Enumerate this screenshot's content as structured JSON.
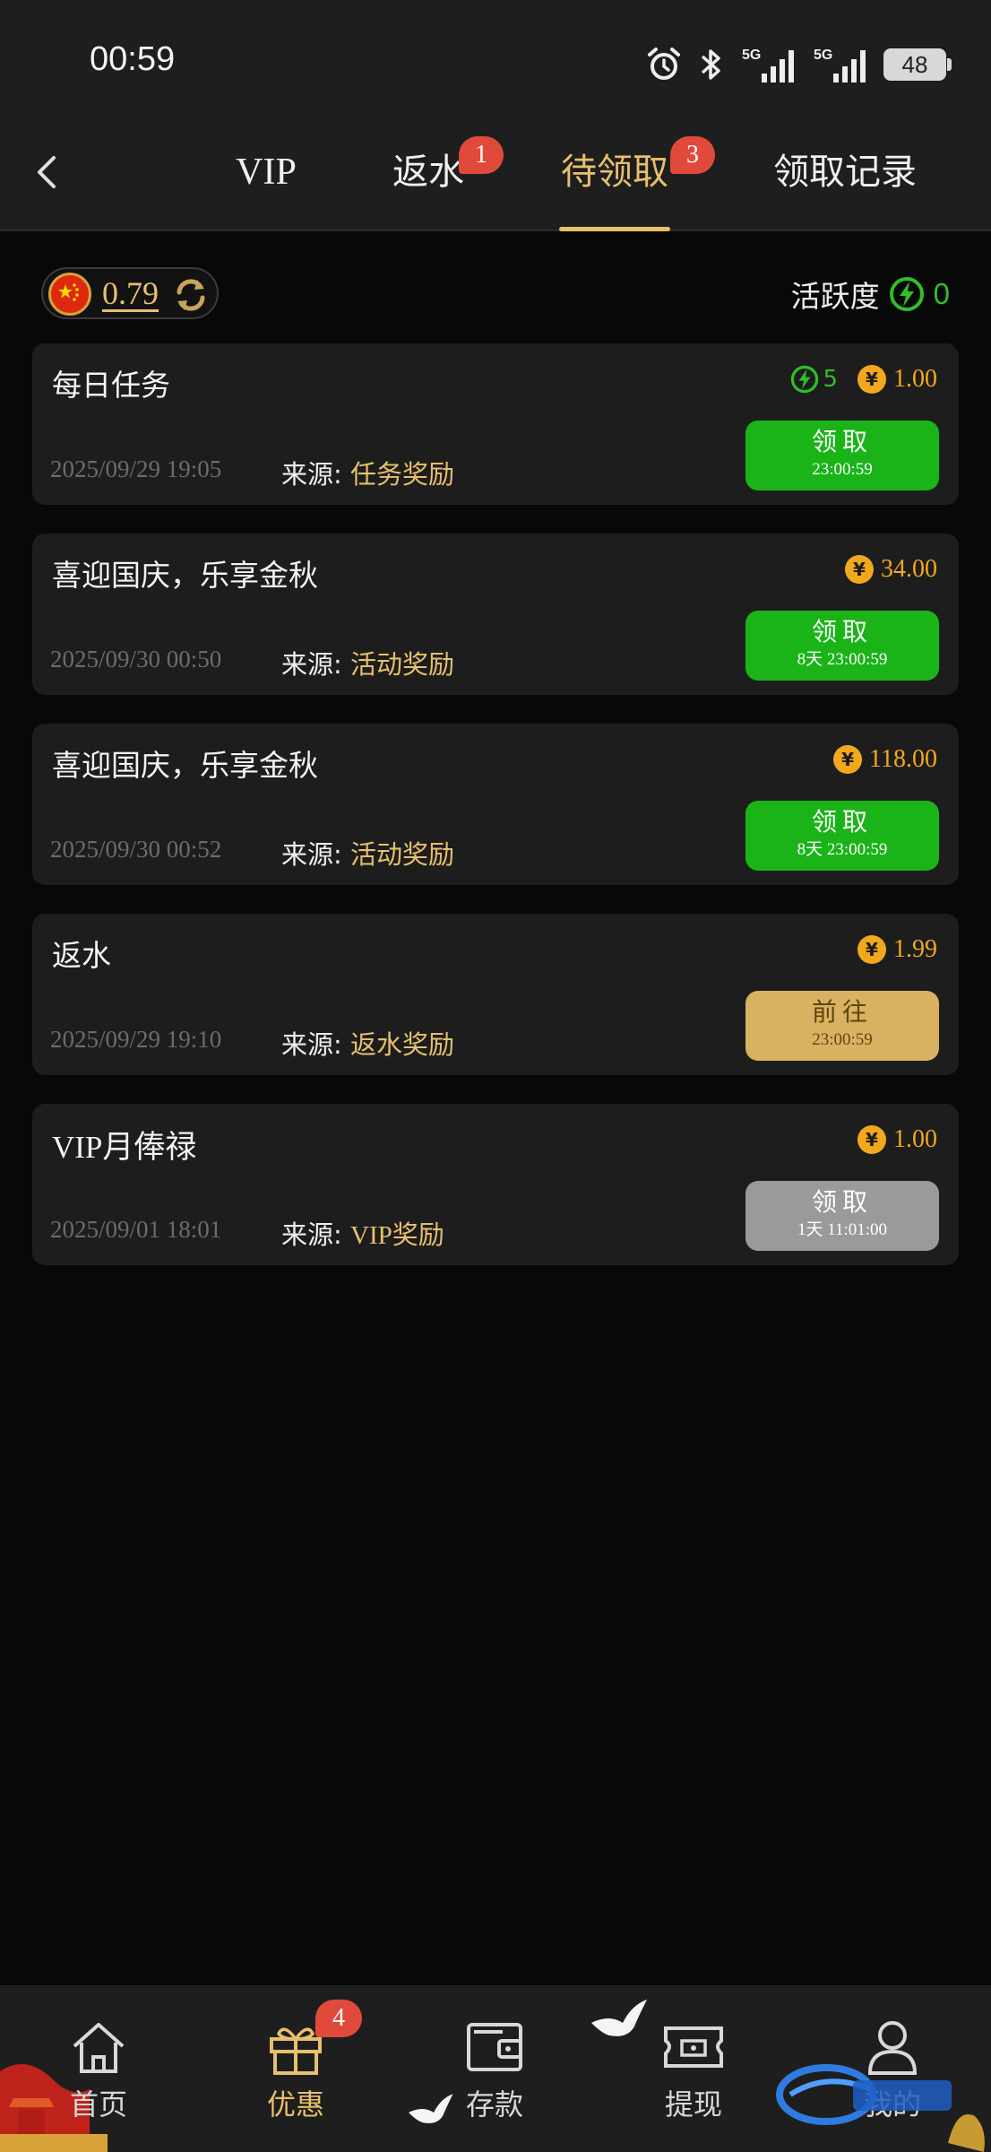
{
  "status_bar": {
    "time": "00:59",
    "battery": "48",
    "network_1": "5G",
    "network_2": "5G"
  },
  "tabs": [
    {
      "label": "VIP",
      "active": false,
      "badge": ""
    },
    {
      "label": "返水",
      "active": false,
      "badge": "1"
    },
    {
      "label": "待领取",
      "active": true,
      "badge": "3"
    },
    {
      "label": "领取记录",
      "active": false,
      "badge": ""
    }
  ],
  "wallet": {
    "amount": "0.79"
  },
  "activity": {
    "label": "活跃度",
    "value": "0"
  },
  "source_label": "来源: ",
  "cards": [
    {
      "title": "每日任务",
      "points": "5",
      "amount": "1.00",
      "date": "2025/09/29 19:05",
      "source": "任务奖励",
      "button_label": "领取",
      "button_timer": "23:00:59",
      "button_style": "green"
    },
    {
      "title": "喜迎国庆，乐享金秋",
      "points": "",
      "amount": "34.00",
      "date": "2025/09/30 00:50",
      "source": "活动奖励",
      "button_label": "领取",
      "button_timer": "8天 23:00:59",
      "button_style": "green"
    },
    {
      "title": "喜迎国庆，乐享金秋",
      "points": "",
      "amount": "118.00",
      "date": "2025/09/30 00:52",
      "source": "活动奖励",
      "button_label": "领取",
      "button_timer": "8天 23:00:59",
      "button_style": "green"
    },
    {
      "title": "返水",
      "points": "",
      "amount": "1.99",
      "date": "2025/09/29 19:10",
      "source": "返水奖励",
      "button_label": "前往",
      "button_timer": "23:00:59",
      "button_style": "gold"
    },
    {
      "title": "VIP月俸禄",
      "points": "",
      "amount": "1.00",
      "date": "2025/09/01 18:01",
      "source": "VIP奖励",
      "button_label": "领取",
      "button_timer": "1天 11:01:00",
      "button_style": "gray"
    }
  ],
  "bottom_nav": [
    {
      "label": "首页",
      "icon": "home-icon",
      "active": false
    },
    {
      "label": "优惠",
      "icon": "gift-icon",
      "active": true,
      "badge": "4"
    },
    {
      "label": "存款",
      "icon": "wallet-icon",
      "active": false
    },
    {
      "label": "提现",
      "icon": "ticket-icon",
      "active": false
    },
    {
      "label": "我的",
      "icon": "user-icon",
      "active": false
    }
  ],
  "colors": {
    "accent_gold": "#e7c06d",
    "green": "#1ab418",
    "badge_red": "#e14a3b",
    "amount_orange": "#f2a81d",
    "background": "#080808"
  }
}
